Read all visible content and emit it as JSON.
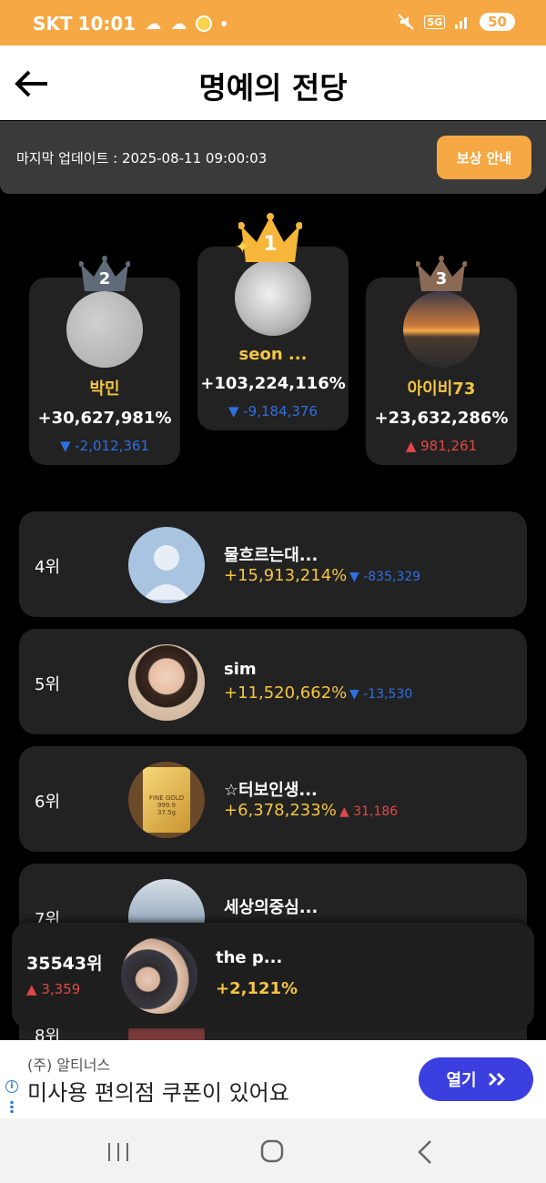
{
  "status_bar": {
    "carrier": "SKT",
    "time": "10:01",
    "network": "5G",
    "battery": "50",
    "icons": [
      "cloud-icon",
      "cloud-icon",
      "coin-icon",
      "dot-icon",
      "mute-icon",
      "signal-icon"
    ]
  },
  "header": {
    "title": "명예의 전당",
    "back_icon": "arrow-left-icon"
  },
  "update": {
    "text": "마지막 업데이트 : 2025-08-11 09:00:03",
    "reward_button": "보상 안내"
  },
  "podium": [
    {
      "rank": "1",
      "name": "seon ...",
      "pct": "+103,224,116%",
      "change": "-9,184,376",
      "dir": "down",
      "crown_color": "#f5b63a"
    },
    {
      "rank": "2",
      "name": "박민",
      "pct": "+30,627,981%",
      "change": "-2,012,361",
      "dir": "down",
      "crown_color": "#5f6b78"
    },
    {
      "rank": "3",
      "name": "아이비73",
      "pct": "+23,632,286%",
      "change": "981,261",
      "dir": "up",
      "crown_color": "#8a6a55"
    }
  ],
  "list": [
    {
      "rank": "4위",
      "name": "물흐르는대...",
      "pct": "+15,913,214%",
      "change": "-835,329",
      "dir": "down"
    },
    {
      "rank": "5위",
      "name": "sim",
      "pct": "+11,520,662%",
      "change": "-13,530",
      "dir": "down"
    },
    {
      "rank": "6위",
      "name": "☆터보인생...",
      "pct": "+6,378,233%",
      "change": "31,186",
      "dir": "up"
    },
    {
      "rank": "7위",
      "name": "세상의중심...",
      "pct": "",
      "change": "",
      "dir": ""
    },
    {
      "rank": "8위",
      "name": "",
      "pct": "",
      "change": "",
      "dir": ""
    }
  ],
  "gold_bar_text": {
    "line1": "FINE GOLD",
    "line2": "999.9",
    "line3": "37.5g"
  },
  "my_rank": {
    "rank": "35543위",
    "change": "3,359",
    "dir": "up",
    "name": "the p...",
    "pct": "+2,121%"
  },
  "ad": {
    "sponsor": "(주) 알티너스",
    "text": "미사용 편의점 쿠폰이 있어요",
    "button": "열기",
    "info": "i"
  },
  "nav": {
    "icons": [
      "recents-icon",
      "home-icon",
      "back-icon"
    ]
  },
  "colors": {
    "accent": "#f5a843",
    "gold_text": "#f5c542",
    "down": "#2f6fe0",
    "up": "#e04848",
    "ad_button": "#3b3fe0"
  }
}
